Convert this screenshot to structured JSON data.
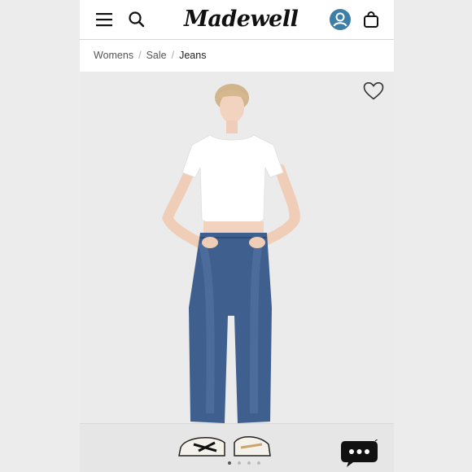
{
  "header": {
    "logo_text": "Madewell",
    "icons": [
      "menu-icon",
      "search-icon",
      "account-icon",
      "bag-icon"
    ],
    "account_color": "#3d7ea6"
  },
  "breadcrumb": {
    "items": [
      "Womens",
      "Sale",
      "Jeans"
    ],
    "separator": "/"
  },
  "product_image": {
    "description_icon": "wishlist-heart-icon",
    "carousel_total": 4,
    "carousel_active": 1
  },
  "chat": {
    "icon": "chat-bubble-icon",
    "color": "#111111"
  }
}
